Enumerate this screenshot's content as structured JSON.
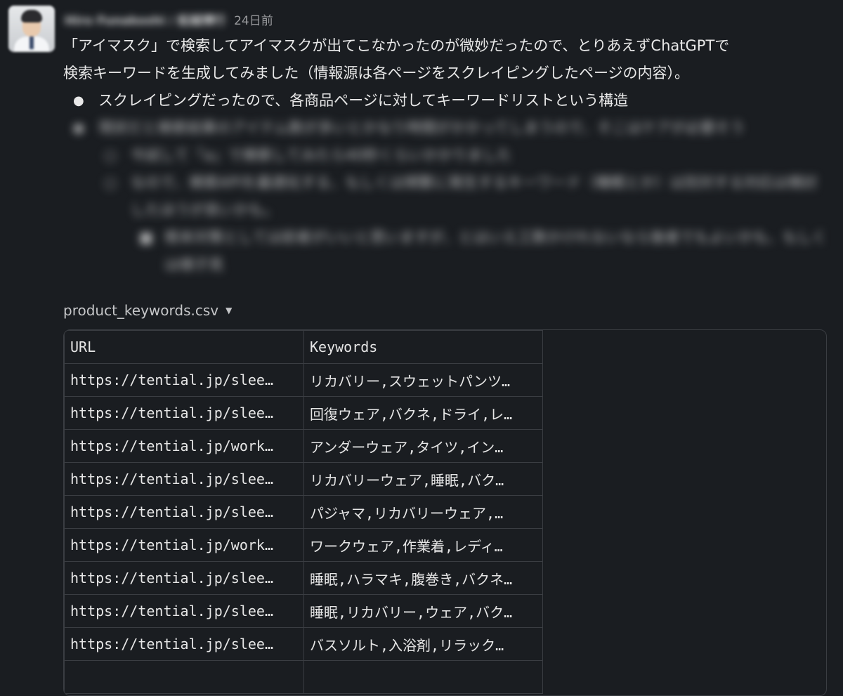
{
  "post": {
    "username": "Hiro Funakoshi / 舩越博行",
    "timestamp": "24日前",
    "line1": "「アイマスク」で検索してアイマスクが出てこなかったのが微妙だったので、とりあえずChatGPTで",
    "line2": "検索キーワードを生成してみました（情報源は各ページをスクレイピングしたページの内容）。",
    "bullets": [
      {
        "text": "スクレイピングだったので、各商品ページに対してキーワードリストという構造",
        "blurred": false
      },
      {
        "text": "現状だと検索結果のアイテム数が多いとかなり時間がかかってしまうので、そこはケアが必要そう",
        "blurred": true
      }
    ],
    "sub_bullets": [
      "今試して「a」で検索してみたら40秒くらいかかりました",
      "なので、検索APIを最適化する、もしくは頻繁に発生するキーワード（睡眠とか）は別対する対応は検討したほうが良いかも。"
    ],
    "subsub_bullets": [
      "根本対策としては前者がいいと思いますが、とはいえ工数かけれないなら後者でもよいかも、もしくは様子見"
    ]
  },
  "file": {
    "name": "product_keywords.csv",
    "caret_icon": "caret-down-icon"
  },
  "table": {
    "headers": [
      "URL",
      "Keywords"
    ],
    "rows": [
      [
        "https://tential.jp/slee…",
        "リカバリー,スウェットパンツ…"
      ],
      [
        "https://tential.jp/slee…",
        "回復ウェア,バクネ,ドライ,レ…"
      ],
      [
        "https://tential.jp/work…",
        "アンダーウェア,タイツ,イン…"
      ],
      [
        "https://tential.jp/slee…",
        "リカバリーウェア,睡眠,バク…"
      ],
      [
        "https://tential.jp/slee…",
        "パジャマ,リカバリーウェア,…"
      ],
      [
        "https://tential.jp/work…",
        "ワークウェア,作業着,レディ…"
      ],
      [
        "https://tential.jp/slee…",
        "睡眠,ハラマキ,腹巻き,バクネ…"
      ],
      [
        "https://tential.jp/slee…",
        "睡眠,リカバリー,ウェア,バク…"
      ],
      [
        "https://tential.jp/slee…",
        "バスソルト,入浴剤,リラック…"
      ],
      [
        "",
        ""
      ]
    ]
  }
}
